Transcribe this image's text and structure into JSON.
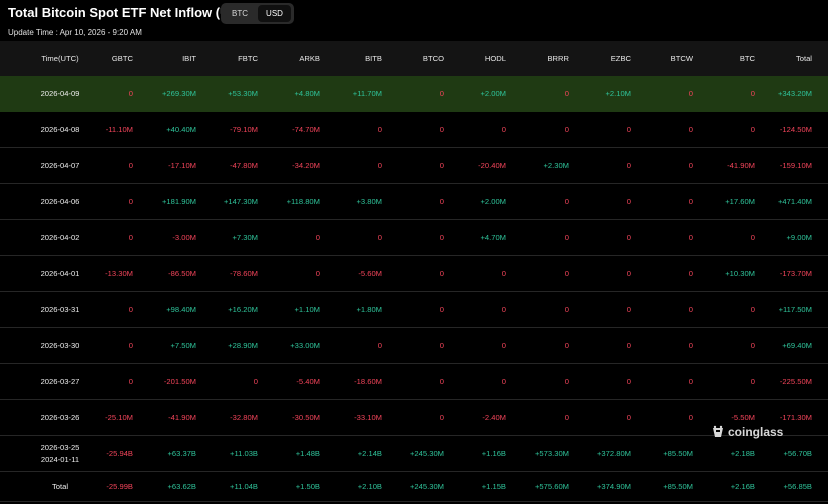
{
  "header": {
    "title": "Total Bitcoin Spot ETF Net Inflow (USD)",
    "update_time": "Update Time : Apr 10, 2026 - 9:20 AM"
  },
  "toggle": {
    "options": [
      "BTC",
      "USD"
    ],
    "selected": "USD"
  },
  "table": {
    "columns": [
      "Time(UTC)",
      "GBTC",
      "IBIT",
      "FBTC",
      "ARKB",
      "BITB",
      "BTCO",
      "HODL",
      "BRRR",
      "EZBC",
      "BTCW",
      "BTC",
      "Total"
    ],
    "rows": [
      {
        "date": [
          "2026-04-09"
        ],
        "highlight": true,
        "cells": [
          "0",
          "+269.30M",
          "+53.30M",
          "+4.80M",
          "+11.70M",
          "0",
          "+2.00M",
          "0",
          "+2.10M",
          "0",
          "0",
          "+343.20M"
        ]
      },
      {
        "date": [
          "2026-04-08"
        ],
        "cells": [
          "-11.10M",
          "+40.40M",
          "-79.10M",
          "-74.70M",
          "0",
          "0",
          "0",
          "0",
          "0",
          "0",
          "0",
          "-124.50M"
        ]
      },
      {
        "date": [
          "2026-04-07"
        ],
        "cells": [
          "0",
          "-17.10M",
          "-47.80M",
          "-34.20M",
          "0",
          "0",
          "-20.40M",
          "+2.30M",
          "0",
          "0",
          "-41.90M",
          "-159.10M"
        ]
      },
      {
        "date": [
          "2026-04-06"
        ],
        "cells": [
          "0",
          "+181.90M",
          "+147.30M",
          "+118.80M",
          "+3.80M",
          "0",
          "+2.00M",
          "0",
          "0",
          "0",
          "+17.60M",
          "+471.40M"
        ]
      },
      {
        "date": [
          "2026-04-02"
        ],
        "cells": [
          "0",
          "-3.00M",
          "+7.30M",
          "0",
          "0",
          "0",
          "+4.70M",
          "0",
          "0",
          "0",
          "0",
          "+9.00M"
        ]
      },
      {
        "date": [
          "2026-04-01"
        ],
        "cells": [
          "-13.30M",
          "-86.50M",
          "-78.60M",
          "0",
          "-5.60M",
          "0",
          "0",
          "0",
          "0",
          "0",
          "+10.30M",
          "-173.70M"
        ]
      },
      {
        "date": [
          "2026-03-31"
        ],
        "cells": [
          "0",
          "+98.40M",
          "+16.20M",
          "+1.10M",
          "+1.80M",
          "0",
          "0",
          "0",
          "0",
          "0",
          "0",
          "+117.50M"
        ]
      },
      {
        "date": [
          "2026-03-30"
        ],
        "cells": [
          "0",
          "+7.50M",
          "+28.90M",
          "+33.00M",
          "0",
          "0",
          "0",
          "0",
          "0",
          "0",
          "0",
          "+69.40M"
        ]
      },
      {
        "date": [
          "2026-03-27"
        ],
        "cells": [
          "0",
          "-201.50M",
          "0",
          "-5.40M",
          "-18.60M",
          "0",
          "0",
          "0",
          "0",
          "0",
          "0",
          "-225.50M"
        ]
      },
      {
        "date": [
          "2026-03-26"
        ],
        "cells": [
          "-25.10M",
          "-41.90M",
          "-32.80M",
          "-30.50M",
          "-33.10M",
          "0",
          "-2.40M",
          "0",
          "0",
          "0",
          "-5.50M",
          "-171.30M"
        ]
      },
      {
        "date": [
          "2026-03-25",
          "2024-01-11"
        ],
        "cells": [
          "-25.94B",
          "+63.37B",
          "+11.03B",
          "+1.48B",
          "+2.14B",
          "+245.30M",
          "+1.16B",
          "+573.30M",
          "+372.80M",
          "+85.50M",
          "+2.18B",
          "+56.70B"
        ]
      },
      {
        "date": [
          "Total"
        ],
        "cells": [
          "-25.99B",
          "+63.62B",
          "+11.04B",
          "+1.50B",
          "+2.10B",
          "+245.30M",
          "+1.15B",
          "+575.60M",
          "+374.90M",
          "+85.50M",
          "+2.16B",
          "+56.85B"
        ]
      }
    ]
  },
  "watermark": {
    "text": "coinglass",
    "icon": "coinglass-logo-icon"
  },
  "colors": {
    "positive": "#2fc39a",
    "negative": "#f2445a",
    "highlight_row": "#1f3a13",
    "header_row": "#141414",
    "background": "#000000"
  }
}
